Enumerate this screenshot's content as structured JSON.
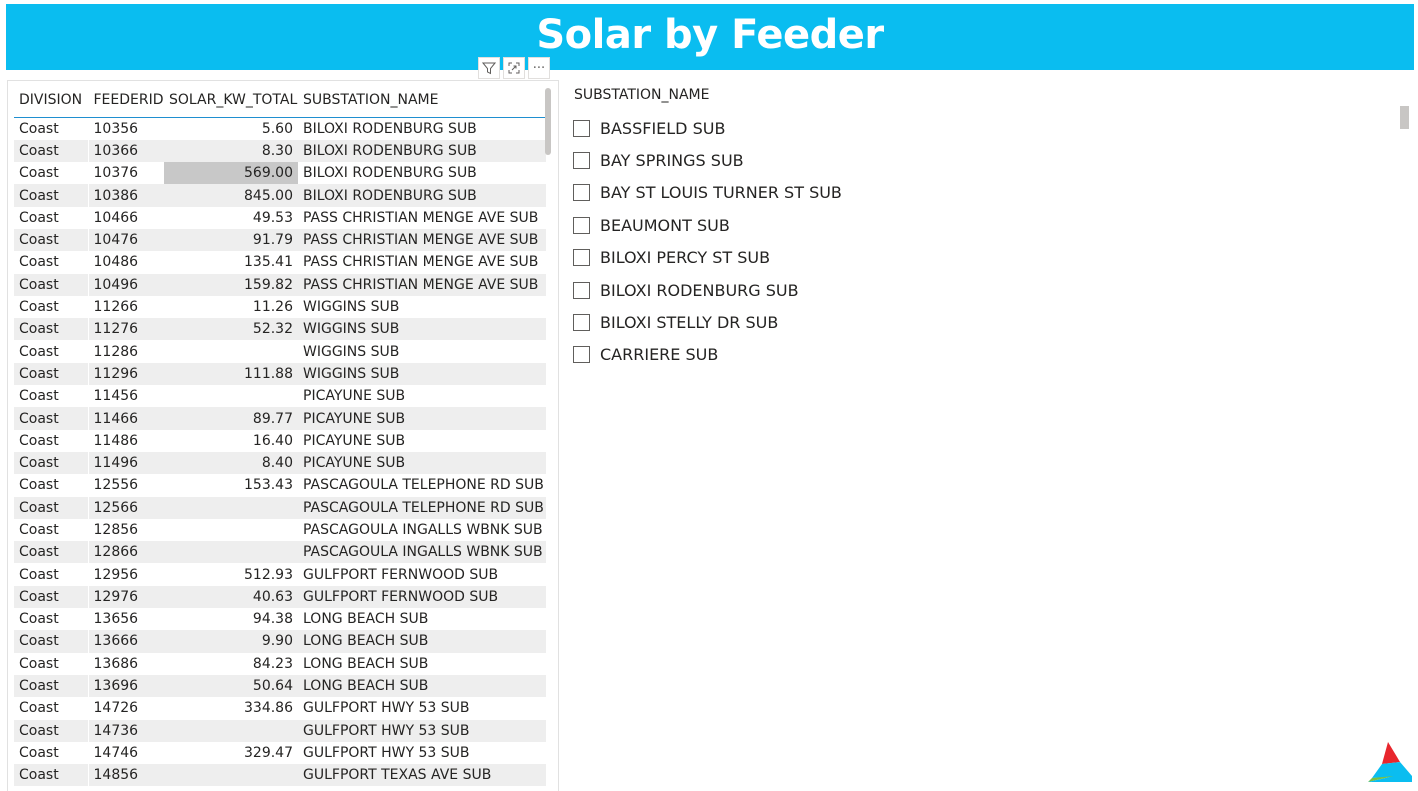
{
  "title": "Solar by Feeder",
  "visual_header": {
    "filter_icon": "filter-icon",
    "focus_icon": "focus-mode-icon",
    "more_icon": "more-options-icon",
    "more_label": "···"
  },
  "table": {
    "columns": [
      "DIVISION",
      "FEEDERID",
      "SOLAR_KW_TOTAL",
      "SUBSTATION_NAME"
    ],
    "rows": [
      [
        "Coast",
        "10356",
        "5.60",
        "BILOXI RODENBURG SUB"
      ],
      [
        "Coast",
        "10366",
        "8.30",
        "BILOXI RODENBURG SUB"
      ],
      [
        "Coast",
        "10376",
        "569.00",
        "BILOXI RODENBURG SUB"
      ],
      [
        "Coast",
        "10386",
        "845.00",
        "BILOXI RODENBURG SUB"
      ],
      [
        "Coast",
        "10466",
        "49.53",
        "PASS CHRISTIAN MENGE AVE SUB"
      ],
      [
        "Coast",
        "10476",
        "91.79",
        "PASS CHRISTIAN MENGE AVE SUB"
      ],
      [
        "Coast",
        "10486",
        "135.41",
        "PASS CHRISTIAN MENGE AVE SUB"
      ],
      [
        "Coast",
        "10496",
        "159.82",
        "PASS CHRISTIAN MENGE AVE SUB"
      ],
      [
        "Coast",
        "11266",
        "11.26",
        "WIGGINS SUB"
      ],
      [
        "Coast",
        "11276",
        "52.32",
        "WIGGINS SUB"
      ],
      [
        "Coast",
        "11286",
        "",
        "WIGGINS SUB"
      ],
      [
        "Coast",
        "11296",
        "111.88",
        "WIGGINS SUB"
      ],
      [
        "Coast",
        "11456",
        "",
        "PICAYUNE SUB"
      ],
      [
        "Coast",
        "11466",
        "89.77",
        "PICAYUNE SUB"
      ],
      [
        "Coast",
        "11486",
        "16.40",
        "PICAYUNE SUB"
      ],
      [
        "Coast",
        "11496",
        "8.40",
        "PICAYUNE SUB"
      ],
      [
        "Coast",
        "12556",
        "153.43",
        "PASCAGOULA TELEPHONE RD SUB"
      ],
      [
        "Coast",
        "12566",
        "",
        "PASCAGOULA TELEPHONE RD SUB"
      ],
      [
        "Coast",
        "12856",
        "",
        "PASCAGOULA INGALLS WBNK SUB"
      ],
      [
        "Coast",
        "12866",
        "",
        "PASCAGOULA INGALLS WBNK SUB"
      ],
      [
        "Coast",
        "12956",
        "512.93",
        "GULFPORT FERNWOOD SUB"
      ],
      [
        "Coast",
        "12976",
        "40.63",
        "GULFPORT FERNWOOD SUB"
      ],
      [
        "Coast",
        "13656",
        "94.38",
        "LONG BEACH SUB"
      ],
      [
        "Coast",
        "13666",
        "9.90",
        "LONG BEACH SUB"
      ],
      [
        "Coast",
        "13686",
        "84.23",
        "LONG BEACH SUB"
      ],
      [
        "Coast",
        "13696",
        "50.64",
        "LONG BEACH SUB"
      ],
      [
        "Coast",
        "14726",
        "334.86",
        "GULFPORT HWY 53 SUB"
      ],
      [
        "Coast",
        "14736",
        "",
        "GULFPORT HWY 53 SUB"
      ],
      [
        "Coast",
        "14746",
        "329.47",
        "GULFPORT HWY 53 SUB"
      ],
      [
        "Coast",
        "14856",
        "",
        "GULFPORT TEXAS AVE SUB"
      ]
    ],
    "highlighted_row_index": 2
  },
  "slicer": {
    "header": "SUBSTATION_NAME",
    "items": [
      "BASSFIELD SUB",
      "BAY SPRINGS SUB",
      "BAY ST LOUIS TURNER ST SUB",
      "BEAUMONT SUB",
      "BILOXI PERCY ST SUB",
      "BILOXI RODENBURG SUB",
      "BILOXI STELLY DR SUB",
      "CARRIERE SUB"
    ]
  },
  "colors": {
    "title_bar": "#0abdf0",
    "header_underline": "#1f8fd0",
    "row_alt": "#eeeeee",
    "row_highlight": "#c8c8c8"
  }
}
